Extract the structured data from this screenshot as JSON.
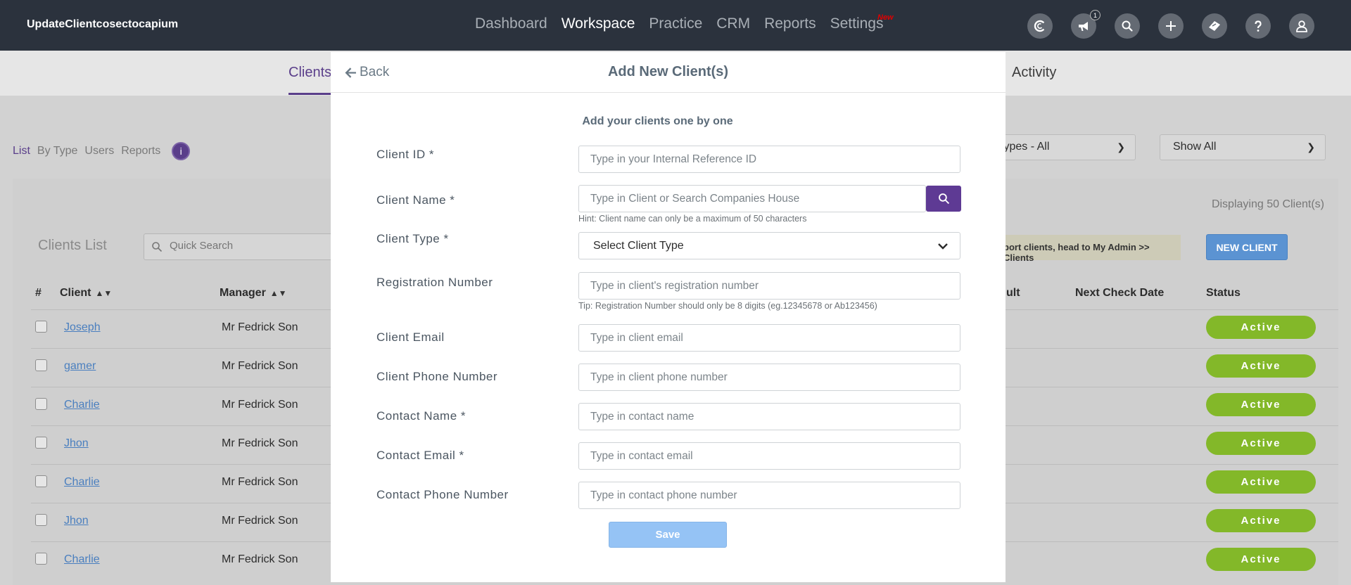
{
  "app": {
    "title": "UpdateClientcosectocapium"
  },
  "nav": {
    "items": [
      "Dashboard",
      "Workspace",
      "Practice",
      "CRM",
      "Reports",
      "Settings"
    ],
    "new_badge": "New",
    "notification_count": "1"
  },
  "subnav": {
    "clients": "Clients",
    "activity": "Activity"
  },
  "view_tabs": [
    "List",
    "By Type",
    "Users",
    "Reports"
  ],
  "filters": {
    "types": "t Types - All",
    "show": "Show All"
  },
  "displaying": "Displaying 50 Client(s)",
  "clients_list": {
    "title": "Clients List",
    "search_placeholder": "Quick Search",
    "import_note": "port clients, head to My Admin >> Clients",
    "new_client": "NEW CLIENT",
    "headers": {
      "num": "#",
      "client": "Client",
      "manager": "Manager",
      "ult": "ult",
      "next_check": "Next Check Date",
      "status": "Status"
    },
    "rows": [
      {
        "client": "Joseph",
        "manager": "Mr Fedrick Son",
        "status": "Active"
      },
      {
        "client": "gamer",
        "manager": "Mr Fedrick Son",
        "status": "Active"
      },
      {
        "client": "Charlie",
        "manager": "Mr Fedrick Son",
        "status": "Active"
      },
      {
        "client": "Jhon",
        "manager": "Mr Fedrick Son",
        "status": "Active"
      },
      {
        "client": "Charlie",
        "manager": "Mr Fedrick Son",
        "status": "Active"
      },
      {
        "client": "Jhon",
        "manager": "Mr Fedrick Son",
        "status": "Active"
      },
      {
        "client": "Charlie",
        "manager": "Mr Fedrick Son",
        "status": "Active"
      }
    ]
  },
  "modal": {
    "back": "Back",
    "title": "Add New Client(s)",
    "subtitle": "Add your clients one by one",
    "client_id": {
      "label": "Client ID *",
      "placeholder": "Type in your Internal Reference ID"
    },
    "client_name": {
      "label": "Client Name *",
      "placeholder": "Type in Client or Search Companies House",
      "hint": "Hint: Client name can only be a maximum of 50 characters"
    },
    "client_type": {
      "label": "Client Type *",
      "value": "Select Client Type"
    },
    "registration": {
      "label": "Registration Number",
      "placeholder": "Type in client's registration number",
      "tip": "Tip: Registration Number should only be 8 digits (eg.12345678 or Ab123456)"
    },
    "client_email": {
      "label": "Client Email",
      "placeholder": "Type in client email"
    },
    "client_phone": {
      "label": "Client Phone Number",
      "placeholder": "Type in client phone number"
    },
    "contact_name": {
      "label": "Contact Name *",
      "placeholder": "Type in contact name"
    },
    "contact_email": {
      "label": "Contact Email *",
      "placeholder": "Type in contact email"
    },
    "contact_phone": {
      "label": "Contact Phone Number",
      "placeholder": "Type in contact phone number"
    },
    "save": "Save"
  },
  "colors": {
    "nav_bg": "#2b323d",
    "accent": "#5e3a94",
    "status_active": "#83b829",
    "save_btn": "#95c3f5",
    "new_client": "#5b93d2"
  },
  "icons": [
    "capium-logo-icon",
    "megaphone-icon",
    "search-icon",
    "plus-icon",
    "ticket-icon",
    "help-icon",
    "user-icon",
    "info-icon",
    "arrow-left-icon",
    "chevron-down-icon"
  ]
}
